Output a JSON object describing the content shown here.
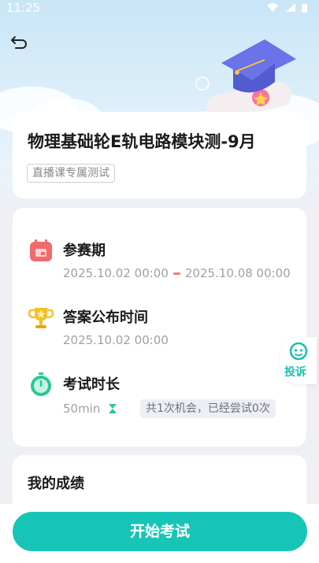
{
  "status_bar": {
    "time": "11:25"
  },
  "exam": {
    "title": "物理基础轮E轨电路模块测-9月",
    "tag": "直播课专属测试"
  },
  "info": {
    "period": {
      "label": "参赛期",
      "start": "2025.10.02 00:00",
      "end": "2025.10.08 00:00"
    },
    "answer_release": {
      "label": "答案公布时间",
      "time": "2025.10.02 00:00"
    },
    "duration": {
      "label": "考试时长",
      "value": "50min",
      "chances": "共1次机会，已经尝试0次"
    }
  },
  "score": {
    "title": "我的成绩"
  },
  "complain": {
    "label": "投诉"
  },
  "start_button": {
    "label": "开始考试"
  },
  "colors": {
    "accent": "#17c5b7",
    "calendar": "#f06b6b",
    "trophy": "#f5c02a",
    "timer": "#27c98f"
  }
}
